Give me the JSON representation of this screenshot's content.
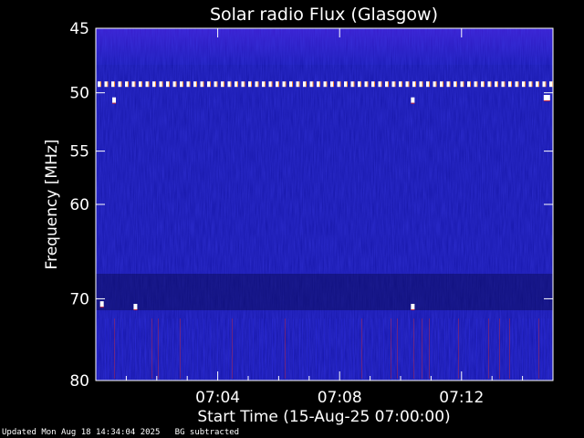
{
  "footer": {
    "updated": "Updated Mon Aug 18 14:34:04 2025",
    "note": "BG subtracted"
  },
  "colors": {
    "background": "#000000",
    "plot_base": "#1616a8",
    "hot": "#ffffff",
    "warm": "#ff8a3a",
    "cool": "#c8283c"
  },
  "chart_data": {
    "type": "heatmap",
    "title": "Solar radio Flux (Glasgow)",
    "xlabel": "Start Time (15-Aug-25 07:00:00)",
    "ylabel": "Frequency [MHz]",
    "x_unit": "minutes after 07:00",
    "xlim": [
      0,
      15
    ],
    "ylim": [
      45,
      80
    ],
    "y_scale": "log",
    "x_ticks": [
      {
        "value": 4,
        "label": "07:04"
      },
      {
        "value": 8,
        "label": "07:08"
      },
      {
        "value": 12,
        "label": "07:12"
      }
    ],
    "y_ticks": [
      {
        "value": 45,
        "label": "45"
      },
      {
        "value": 50,
        "label": "50"
      },
      {
        "value": 55,
        "label": "55"
      },
      {
        "value": 60,
        "label": "60"
      },
      {
        "value": 70,
        "label": "70"
      },
      {
        "value": 80,
        "label": "80"
      }
    ],
    "features": [
      {
        "kind": "persistent-interference",
        "frequency": 49.3,
        "x_start": 0,
        "x_end": 15
      },
      {
        "kind": "burst",
        "frequency": 50.6,
        "x": 0.6
      },
      {
        "kind": "burst",
        "frequency": 50.6,
        "x": 10.4
      },
      {
        "kind": "burst",
        "frequency": 50.4,
        "x": 14.8
      },
      {
        "kind": "burst",
        "frequency": 70.6,
        "x": 0.2
      },
      {
        "kind": "burst",
        "frequency": 70.9,
        "x": 1.3
      },
      {
        "kind": "burst",
        "frequency": 70.9,
        "x": 10.4
      }
    ],
    "grid": false,
    "colorbar": false
  }
}
